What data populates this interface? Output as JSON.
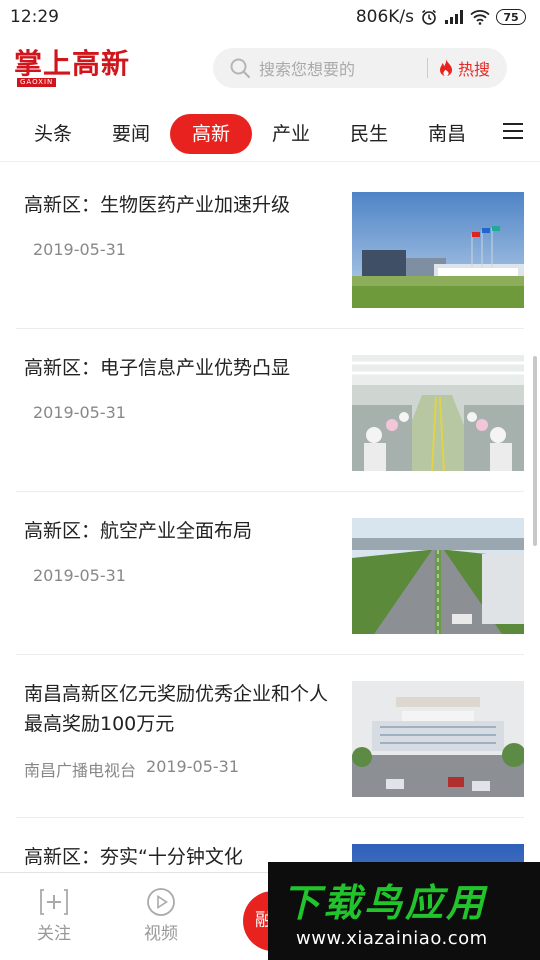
{
  "status_bar": {
    "time": "12:29",
    "network_speed": "806K/s",
    "battery": "75",
    "icons": [
      "alarm-icon",
      "signal-icon",
      "wifi-icon",
      "battery-icon"
    ]
  },
  "header": {
    "logo_text": "掌上高新",
    "logo_sub": "GAOXIN",
    "search_placeholder": "搜索您想要的",
    "hot_label": "热搜"
  },
  "tabs": [
    {
      "label": "头条",
      "active": false
    },
    {
      "label": "要闻",
      "active": false
    },
    {
      "label": "高新",
      "active": true
    },
    {
      "label": "产业",
      "active": false
    },
    {
      "label": "民生",
      "active": false
    },
    {
      "label": "南昌",
      "active": false
    }
  ],
  "news": [
    {
      "title": "高新区：生物医药产业加速升级",
      "source": "",
      "date": "2019-05-31"
    },
    {
      "title": "高新区：电子信息产业优势凸显",
      "source": "",
      "date": "2019-05-31"
    },
    {
      "title": "高新区：航空产业全面布局",
      "source": "",
      "date": "2019-05-31"
    },
    {
      "title": "南昌高新区亿元奖励优秀企业和个人 最高奖励100万元",
      "source": "南昌广播电视台",
      "date": "2019-05-31"
    },
    {
      "title": "高新区：夯实“十分钟文化",
      "source": "",
      "date": ""
    }
  ],
  "bottom_nav": {
    "follow": "关注",
    "video": "视频",
    "center": "融"
  },
  "watermark": {
    "title": "下载鸟应用",
    "url": "www.xiazainiao.com"
  },
  "colors": {
    "accent": "#e8231f",
    "watermark_green": "#22c42c"
  }
}
